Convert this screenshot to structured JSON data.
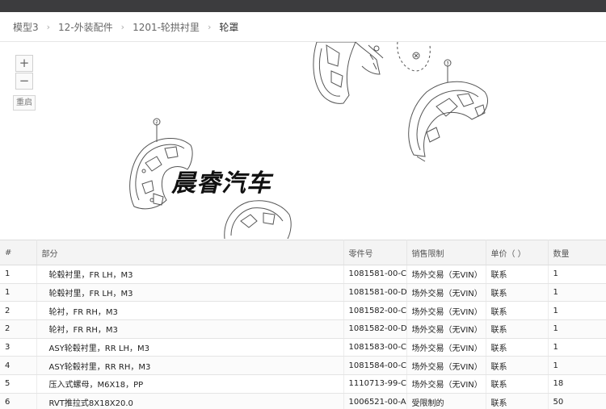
{
  "breadcrumb": {
    "items": [
      "模型3",
      "12-外装配件",
      "1201-轮拱衬里",
      "轮罩"
    ],
    "separator": "›"
  },
  "diagram": {
    "zoom_in_label": "+",
    "zoom_out_label": "−",
    "reset_label": "重启",
    "watermark": "晨睿汽车",
    "callouts": [
      "2",
      "3"
    ]
  },
  "table": {
    "headers": [
      "#",
      "部分",
      "零件号",
      "销售限制",
      "单价（ ）",
      "数量"
    ],
    "rows": [
      [
        "1",
        "轮毂衬里，FR LH，M3",
        "1081581-00-C",
        "场外交易（无VIN）",
        "联系",
        "1"
      ],
      [
        "1",
        "轮毂衬里，FR LH，M3",
        "1081581-00-D",
        "场外交易（无VIN）",
        "联系",
        "1"
      ],
      [
        "2",
        "轮衬，FR RH，M3",
        "1081582-00-C",
        "场外交易（无VIN）",
        "联系",
        "1"
      ],
      [
        "2",
        "轮衬，FR RH，M3",
        "1081582-00-D",
        "场外交易（无VIN）",
        "联系",
        "1"
      ],
      [
        "3",
        "ASY轮毂衬里，RR LH，M3",
        "1081583-00-C",
        "场外交易（无VIN）",
        "联系",
        "1"
      ],
      [
        "4",
        "ASY轮毂衬里，RR RH，M3",
        "1081584-00-C",
        "场外交易（无VIN）",
        "联系",
        "1"
      ],
      [
        "5",
        "压入式螺母，M6X18，PP",
        "1110713-99-C",
        "场外交易（无VIN）",
        "联系",
        "18"
      ],
      [
        "6",
        "RVT推拉式8X18X20.0",
        "1006521-00-A",
        "受限制的",
        "联系",
        "50"
      ]
    ]
  },
  "colors": {
    "topbar": "#3c3c3e",
    "header_bg": "#f4f4f4",
    "border": "#dddddd"
  }
}
